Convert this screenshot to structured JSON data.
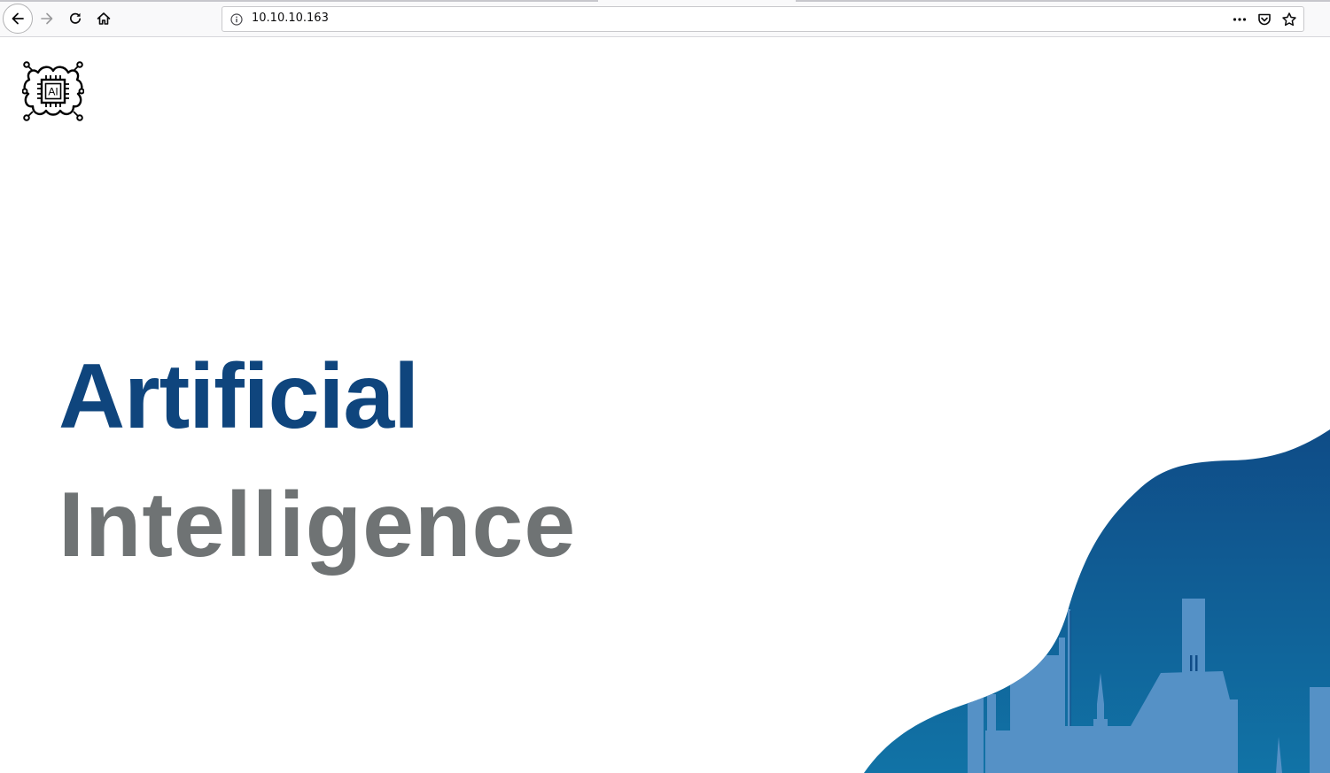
{
  "browser": {
    "url": "10.10.10.163",
    "icons": {
      "back": "back-arrow-icon",
      "forward": "forward-arrow-icon",
      "reload": "reload-icon",
      "home": "home-icon",
      "info": "info-icon",
      "more": "more-actions-icon",
      "pocket": "pocket-icon",
      "bookmark": "bookmark-star-icon"
    }
  },
  "page": {
    "logo_text": "AI",
    "headline_line1": "Artificial",
    "headline_line2": "Intelligence",
    "colors": {
      "primary_blue": "#0f457d",
      "gray": "#6f7374",
      "wave_dark": "#0e4f88",
      "wave_light": "#5591c6"
    }
  }
}
